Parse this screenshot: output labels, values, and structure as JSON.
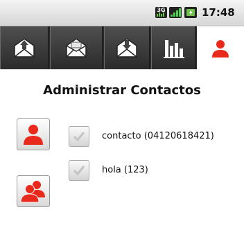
{
  "status_bar": {
    "network_badge": "3G",
    "time": "17:48",
    "icons": [
      "3g-icon",
      "signal-icon",
      "battery-icon"
    ]
  },
  "tabs": [
    {
      "name": "inbox-upload",
      "icon": "envelope-up-icon",
      "active": false
    },
    {
      "name": "open-mail",
      "icon": "envelope-open-icon",
      "active": false
    },
    {
      "name": "inbox-download",
      "icon": "envelope-down-icon",
      "active": false
    },
    {
      "name": "statistics",
      "icon": "bar-chart-icon",
      "active": false
    },
    {
      "name": "contacts",
      "icon": "person-icon",
      "active": true
    }
  ],
  "main": {
    "title": "Administrar Contactos",
    "buttons": [
      {
        "icon": "person-icon"
      },
      {
        "icon": "group-icon"
      }
    ],
    "contacts": [
      {
        "label": "contacto (04120618421)",
        "checked": false
      },
      {
        "label": "hola (123)",
        "checked": false
      }
    ]
  },
  "colors": {
    "accent_red": "#e8291c",
    "tab_bar": "#3a3a3a",
    "status_bar": "#e2e2e2"
  }
}
